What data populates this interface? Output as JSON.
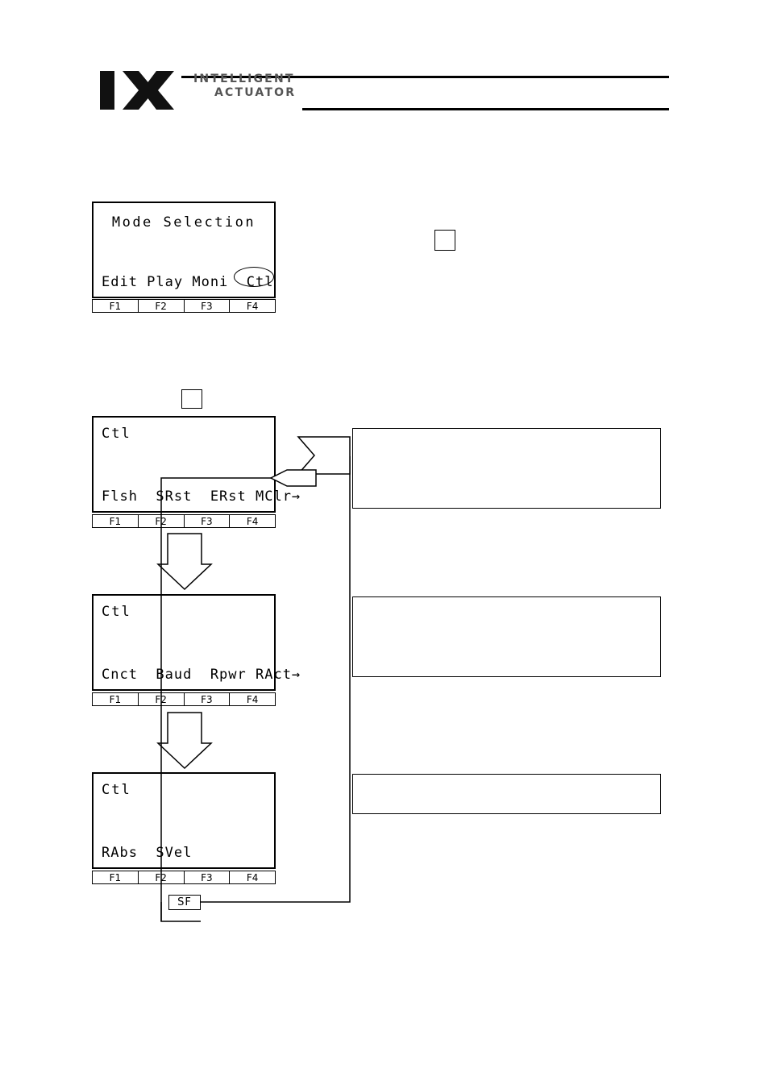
{
  "header": {
    "logo_line1": "INTELLIGENT",
    "logo_line2": "ACTUATOR",
    "logo_mark": "IX"
  },
  "screens": {
    "mode_selection": {
      "title": "Mode Selection",
      "menu": "Edit Play Moni  Ctl",
      "fkeys": [
        "F1",
        "F2",
        "F3",
        "F4"
      ],
      "highlight": "Ctl"
    },
    "ctl_page1": {
      "title": "Ctl",
      "menu": "Flsh  SRst  ERst MClr→",
      "fkeys": [
        "F1",
        "F2",
        "F3",
        "F4"
      ]
    },
    "ctl_page2": {
      "title": "Ctl",
      "menu": "Cnct  Baud  Rpwr RAct→",
      "fkeys": [
        "F1",
        "F2",
        "F3",
        "F4"
      ]
    },
    "ctl_page3": {
      "title": "Ctl",
      "menu": "RAbs  SVel",
      "fkeys": [
        "F1",
        "F2",
        "F3",
        "F4"
      ]
    }
  },
  "keys": {
    "blank_key_top": "",
    "blank_key_mid": "",
    "sf_label": "SF"
  },
  "comments": {
    "box1": "",
    "box2": "",
    "box3": ""
  }
}
